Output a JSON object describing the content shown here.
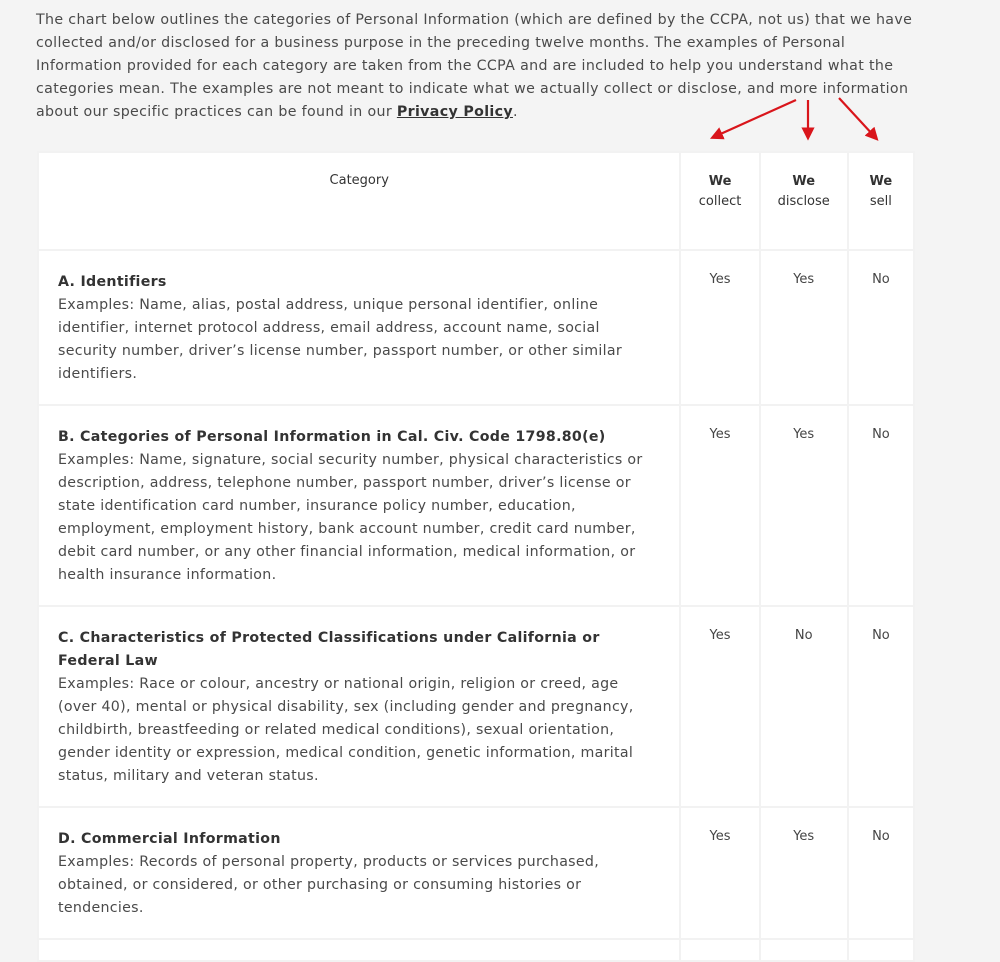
{
  "intro": {
    "text": "The chart below outlines the categories of Personal Information (which are defined by the CCPA, not us) that we have collected and/or disclosed for a business purpose in the preceding twelve months. The examples of Personal Information provided for each category are taken from the CCPA and are included to help you understand what the categories mean. The examples are not meant to indicate what we actually collect or disclose, and more information about our specific practices can be found in our ",
    "link_label": "Privacy Policy",
    "end": "."
  },
  "annotation": {
    "arrow_color": "#d9151b",
    "arrow_count": 3
  },
  "table": {
    "headers": {
      "category": "Category",
      "collect_line1": "We",
      "collect_line2": "collect",
      "disclose_line1": "We",
      "disclose_line2": "disclose",
      "sell_line1": "We",
      "sell_line2": "sell"
    },
    "rows": [
      {
        "title": "A. Identifiers",
        "examples": "Examples: Name, alias, postal address, unique personal identifier, online identifier, internet protocol address, email address, account name, social security number, driver’s license number, passport number, or other similar identifiers.",
        "collect": "Yes",
        "disclose": "Yes",
        "sell": "No"
      },
      {
        "title": "B. Categories of Personal Information in Cal. Civ. Code 1798.80(e)",
        "examples": "Examples: Name, signature, social security number, physical characteristics or description, address, telephone number, passport number, driver’s license or state identification card number, insurance policy number, education, employment, employment history, bank account number, credit card number, debit card number, or any other financial information, medical information, or health insurance information.",
        "collect": "Yes",
        "disclose": "Yes",
        "sell": "No"
      },
      {
        "title": "C. Characteristics of Protected Classifications under California or Federal Law",
        "examples": "Examples: Race or colour, ancestry or national origin, religion or creed, age (over 40), mental or physical disability, sex (including gender and pregnancy, childbirth, breastfeeding or related medical conditions), sexual orientation, gender identity or expression, medical condition, genetic information, marital status, military and veteran status.",
        "collect": "Yes",
        "disclose": "No",
        "sell": "No"
      },
      {
        "title": "D. Commercial Information",
        "examples": "Examples: Records of personal property, products or services purchased, obtained, or considered, or other purchasing or consuming histories or tendencies.",
        "collect": "Yes",
        "disclose": "Yes",
        "sell": "No"
      }
    ]
  }
}
